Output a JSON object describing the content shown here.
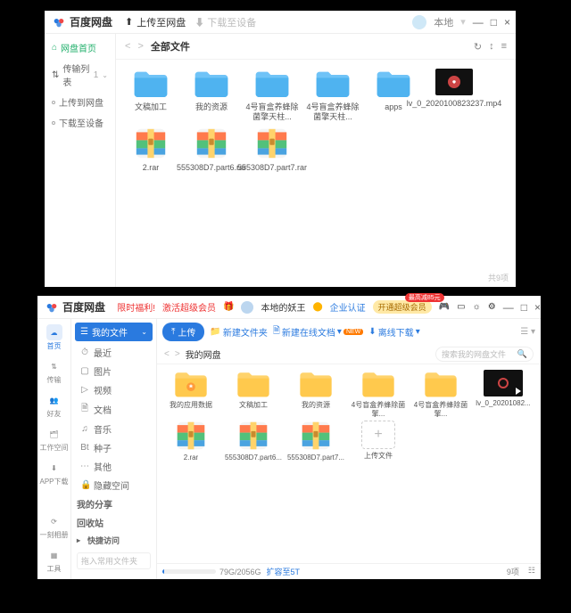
{
  "windowA": {
    "logo_text": "百度网盘",
    "upload_label": "上传至网盘",
    "download_label": "下载至设备",
    "user_label": "本地",
    "win_min": "—",
    "win_max": "□",
    "win_close": "×",
    "sidebar": {
      "home": "网盘首页",
      "transfer": "传输列表",
      "transfer_badge": "1",
      "upload": "上传到网盘",
      "download": "下载至设备"
    },
    "crumb": {
      "back": "<",
      "fwd": ">",
      "title": "全部文件",
      "refresh": "↻",
      "sort": "↕",
      "view": "≡"
    },
    "files": [
      {
        "type": "folder-blue",
        "name": "文稿加工"
      },
      {
        "type": "folder-blue",
        "name": "我的资源"
      },
      {
        "type": "folder-blue",
        "name": "4号盲盒养蜂除菌擎天柱..."
      },
      {
        "type": "folder-blue",
        "name": "4号盲盒养蜂除菌擎天柱..."
      },
      {
        "type": "folder-blue",
        "name": "apps"
      },
      {
        "type": "video",
        "name": "lv_0_2020100823237.mp4"
      },
      {
        "type": "rar",
        "name": "2.rar"
      },
      {
        "type": "rar",
        "name": "555308D7.part6.rar"
      },
      {
        "type": "rar",
        "name": "555308D7.part7.rar"
      }
    ],
    "footer": "共9项"
  },
  "windowB": {
    "logo_text": "百度网盘",
    "top": {
      "promo": "限时福利!",
      "activate": "激活超级会员",
      "user": "本地的妖王",
      "user_vip": "⬤",
      "enterprise": "企业认证",
      "open_vip": "开通超级会员",
      "open_vip_badge": "最高减85元"
    },
    "rail": [
      {
        "icon": "cloud",
        "label": "首页",
        "active": true
      },
      {
        "icon": "transfer",
        "label": "传输"
      },
      {
        "icon": "friends",
        "label": "好友"
      },
      {
        "icon": "workspace",
        "label": "工作空间"
      },
      {
        "icon": "app",
        "label": "APP下载"
      }
    ],
    "rail_bottom": [
      {
        "icon": "refresh",
        "label": "一刻相册"
      },
      {
        "icon": "tools",
        "label": "工具"
      }
    ],
    "side": {
      "myfiles": "我的文件",
      "items": [
        {
          "icon": "⏱",
          "label": "最近"
        },
        {
          "icon": "▢",
          "label": "图片"
        },
        {
          "icon": "▷",
          "label": "视频"
        },
        {
          "icon": "🗎",
          "label": "文档"
        },
        {
          "icon": "♫",
          "label": "音乐"
        },
        {
          "icon": "Bt",
          "label": "种子"
        },
        {
          "icon": "⋯",
          "label": "其他"
        },
        {
          "icon": "🔒",
          "label": "隐藏空间"
        }
      ],
      "myshare": "我的分享",
      "recycle": "回收站",
      "quick": "快捷访问",
      "quick_hint": "拖入常用文件夹"
    },
    "toolbar": {
      "upload": "上传",
      "newfolder": "新建文件夹",
      "newdoc": "新建在线文档",
      "newdoc_badge": "NEW",
      "offline": "离线下载"
    },
    "crumb": {
      "back": "<",
      "fwd": ">",
      "path": "我的网盘",
      "search_ph": "搜索我的网盘文件"
    },
    "files": [
      {
        "type": "folder-star",
        "name": "我的应用数据"
      },
      {
        "type": "folder",
        "name": "文稿加工"
      },
      {
        "type": "folder",
        "name": "我的资源"
      },
      {
        "type": "folder",
        "name": "4号盲盒养蜂除菌擎..."
      },
      {
        "type": "folder",
        "name": "4号盲盒养蜂除菌擎..."
      },
      {
        "type": "video",
        "name": "lv_0_20201082..."
      },
      {
        "type": "rar",
        "name": "2.rar"
      },
      {
        "type": "rar",
        "name": "555308D7.part6..."
      },
      {
        "type": "rar",
        "name": "555308D7.part7..."
      },
      {
        "type": "upload",
        "name": "上传文件"
      }
    ],
    "footer": {
      "quota": "79G/2056G",
      "expand": "扩容至5T",
      "items": "9项"
    }
  }
}
